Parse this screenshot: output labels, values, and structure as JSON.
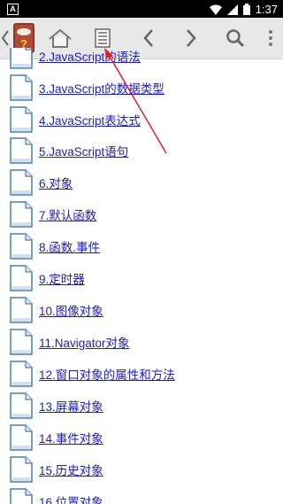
{
  "status": {
    "indicator": "A",
    "time": "1:37"
  },
  "toolbar": {
    "icons": [
      "book-icon",
      "home-icon",
      "list-icon",
      "back-icon",
      "forward-icon",
      "search-icon",
      "more-icon"
    ]
  },
  "list": {
    "items": [
      {
        "label": "2.JavaScript的语法"
      },
      {
        "label": "3.JavaScript的数据类型"
      },
      {
        "label": "4.JavaScript表达式"
      },
      {
        "label": "5.JavaScript语句"
      },
      {
        "label": "6.对象"
      },
      {
        "label": "7.默认函数"
      },
      {
        "label": "8.函数.事件"
      },
      {
        "label": "9.定时器"
      },
      {
        "label": "10.图像对象"
      },
      {
        "label": "11.Navigator对象"
      },
      {
        "label": "12.窗口对象的属性和方法"
      },
      {
        "label": "13.屏幕对象"
      },
      {
        "label": "14.事件对象"
      },
      {
        "label": "15.历史对象"
      },
      {
        "label": "16.位置对象"
      }
    ]
  },
  "colors": {
    "link": "#1a1adc",
    "toolbar": "#e8e8e8",
    "arrow": "#e0202a"
  }
}
